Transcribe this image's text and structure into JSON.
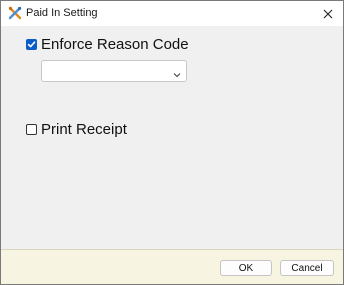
{
  "window": {
    "title": "Paid In Setting",
    "icon": "app-tools-icon",
    "close_icon": "close-icon"
  },
  "settings": {
    "enforce_reason_code": {
      "label": "Enforce Reason Code",
      "checked": true
    },
    "reason_code_select": {
      "value": "",
      "icon": "chevron-down-icon"
    },
    "print_receipt": {
      "label": "Print Receipt",
      "checked": false
    }
  },
  "footer": {
    "ok_label": "OK",
    "cancel_label": "Cancel"
  },
  "colors": {
    "accent": "#0b5cc9",
    "footer_bg": "#f7f5e2",
    "content_bg": "#f0f0f0"
  }
}
